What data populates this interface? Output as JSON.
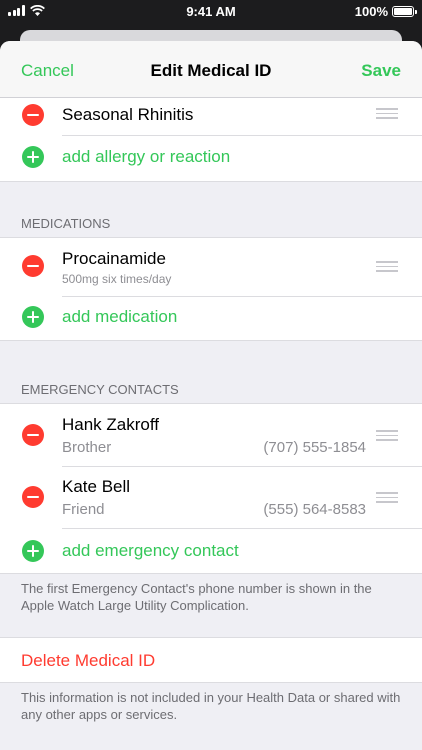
{
  "status_bar": {
    "time": "9:41 AM",
    "battery": "100%"
  },
  "nav": {
    "cancel": "Cancel",
    "title": "Edit Medical ID",
    "save": "Save"
  },
  "allergies": {
    "items": [
      {
        "name": "Seasonal Rhinitis"
      }
    ],
    "add_label": "add allergy or reaction"
  },
  "medications": {
    "header": "MEDICATIONS",
    "items": [
      {
        "name": "Procainamide",
        "detail": "500mg six times/day"
      }
    ],
    "add_label": "add medication"
  },
  "emergency_contacts": {
    "header": "EMERGENCY CONTACTS",
    "items": [
      {
        "name": "Hank Zakroff",
        "relation": "Brother",
        "phone": "(707) 555-1854"
      },
      {
        "name": "Kate Bell",
        "relation": "Friend",
        "phone": "(555) 564-8583"
      }
    ],
    "add_label": "add emergency contact",
    "note": "The first Emergency Contact's phone number is shown in the Apple Watch Large Utility Complication."
  },
  "delete": {
    "label": "Delete Medical ID"
  },
  "privacy_note": "This information is not included in your Health Data or shared with any other apps or services.",
  "colors": {
    "accent_green": "#34c759",
    "destructive_red": "#ff3b30",
    "secondary_text": "#8e8e93"
  },
  "icons": {
    "remove": "remove-circle-icon",
    "add": "add-circle-icon",
    "reorder": "reorder-handle-icon"
  }
}
